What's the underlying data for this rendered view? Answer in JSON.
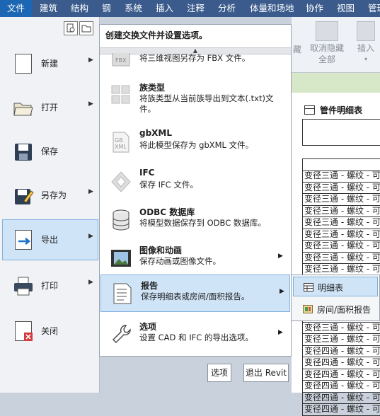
{
  "tabs": [
    "文件",
    "建筑",
    "结构",
    "钢",
    "系统",
    "插入",
    "注释",
    "分析",
    "体量和场地",
    "协作",
    "视图",
    "管理"
  ],
  "ribbon_bg": {
    "btn1": "取消隐藏",
    "btn1b": "全部",
    "btn2": "插入",
    "btn0": "藏"
  },
  "schedule": {
    "title": "管件明细表",
    "rows": [
      "变径三通 - 螺纹 - 可锻",
      "变径三通 - 螺纹 - 可锻",
      "变径三通 - 螺纹 - 可锻",
      "变径三通 - 螺纹 - 可锻",
      "变径三通 - 螺纹 - 可锻",
      "变径三通 - 螺纹 - 可锻",
      "变径三通 - 螺纹 - 可锻",
      "变径三通 - 螺纹 - 可锻",
      "变径三通 - 螺纹 - 可锻",
      "变径三通 - 螺纹 - 可锻",
      "变径三通 - 螺纹 - 可锻",
      "变径三通 - 螺纹 - 可锻",
      "变径三通 - 螺纹 - 可锻",
      "变径三通 - 螺纹 - 可锻",
      "变径三通 - 螺纹 - 可锻",
      "变径四通 - 螺纹 - 可锻",
      "变径四通 - 螺纹 - 可锻",
      "变径四通 - 螺纹 - 可锻",
      "变径四通 - 螺纹 - 可锻",
      "变径四通 - 螺纹 - 可锻",
      "变径四通 - 螺纹 - 可锻"
    ]
  },
  "left_menu": [
    {
      "label": "新建"
    },
    {
      "label": "打开"
    },
    {
      "label": "保存"
    },
    {
      "label": "另存为"
    },
    {
      "label": "导出"
    },
    {
      "label": "打印"
    },
    {
      "label": "关闭"
    }
  ],
  "panel": {
    "title": "创建交换文件并设置选项。",
    "items": [
      {
        "title": "",
        "desc": "将三维视图另存为 FBX 文件。",
        "icon_text": "FBX"
      },
      {
        "title": "族类型",
        "desc": "将族类型从当前族导出到文本(.txt)文件。"
      },
      {
        "title": "gbXML",
        "desc": "将此模型保存为 gbXML 文件。",
        "icon_text": "GB XML"
      },
      {
        "title": "IFC",
        "desc": "保存 IFC 文件。"
      },
      {
        "title": "ODBC 数据库",
        "desc": "将模型数据保存到 ODBC 数据库。"
      },
      {
        "title": "图像和动画",
        "desc": "保存动画或图像文件。"
      },
      {
        "title": "报告",
        "desc": "保存明细表或房间/面积报告。"
      },
      {
        "title": "选项",
        "desc": "设置 CAD 和 IFC 的导出选项。"
      }
    ]
  },
  "buttons": {
    "options": "选项",
    "exit": "退出 Revit"
  },
  "flyout": [
    {
      "label": "明细表"
    },
    {
      "label": "房间/面积报告"
    }
  ],
  "colors": {
    "tabbar": "#3a5b8c",
    "file_tab": "#1c66b4",
    "highlight": "#cfe4f7",
    "highlight_border": "#7fb1de"
  }
}
